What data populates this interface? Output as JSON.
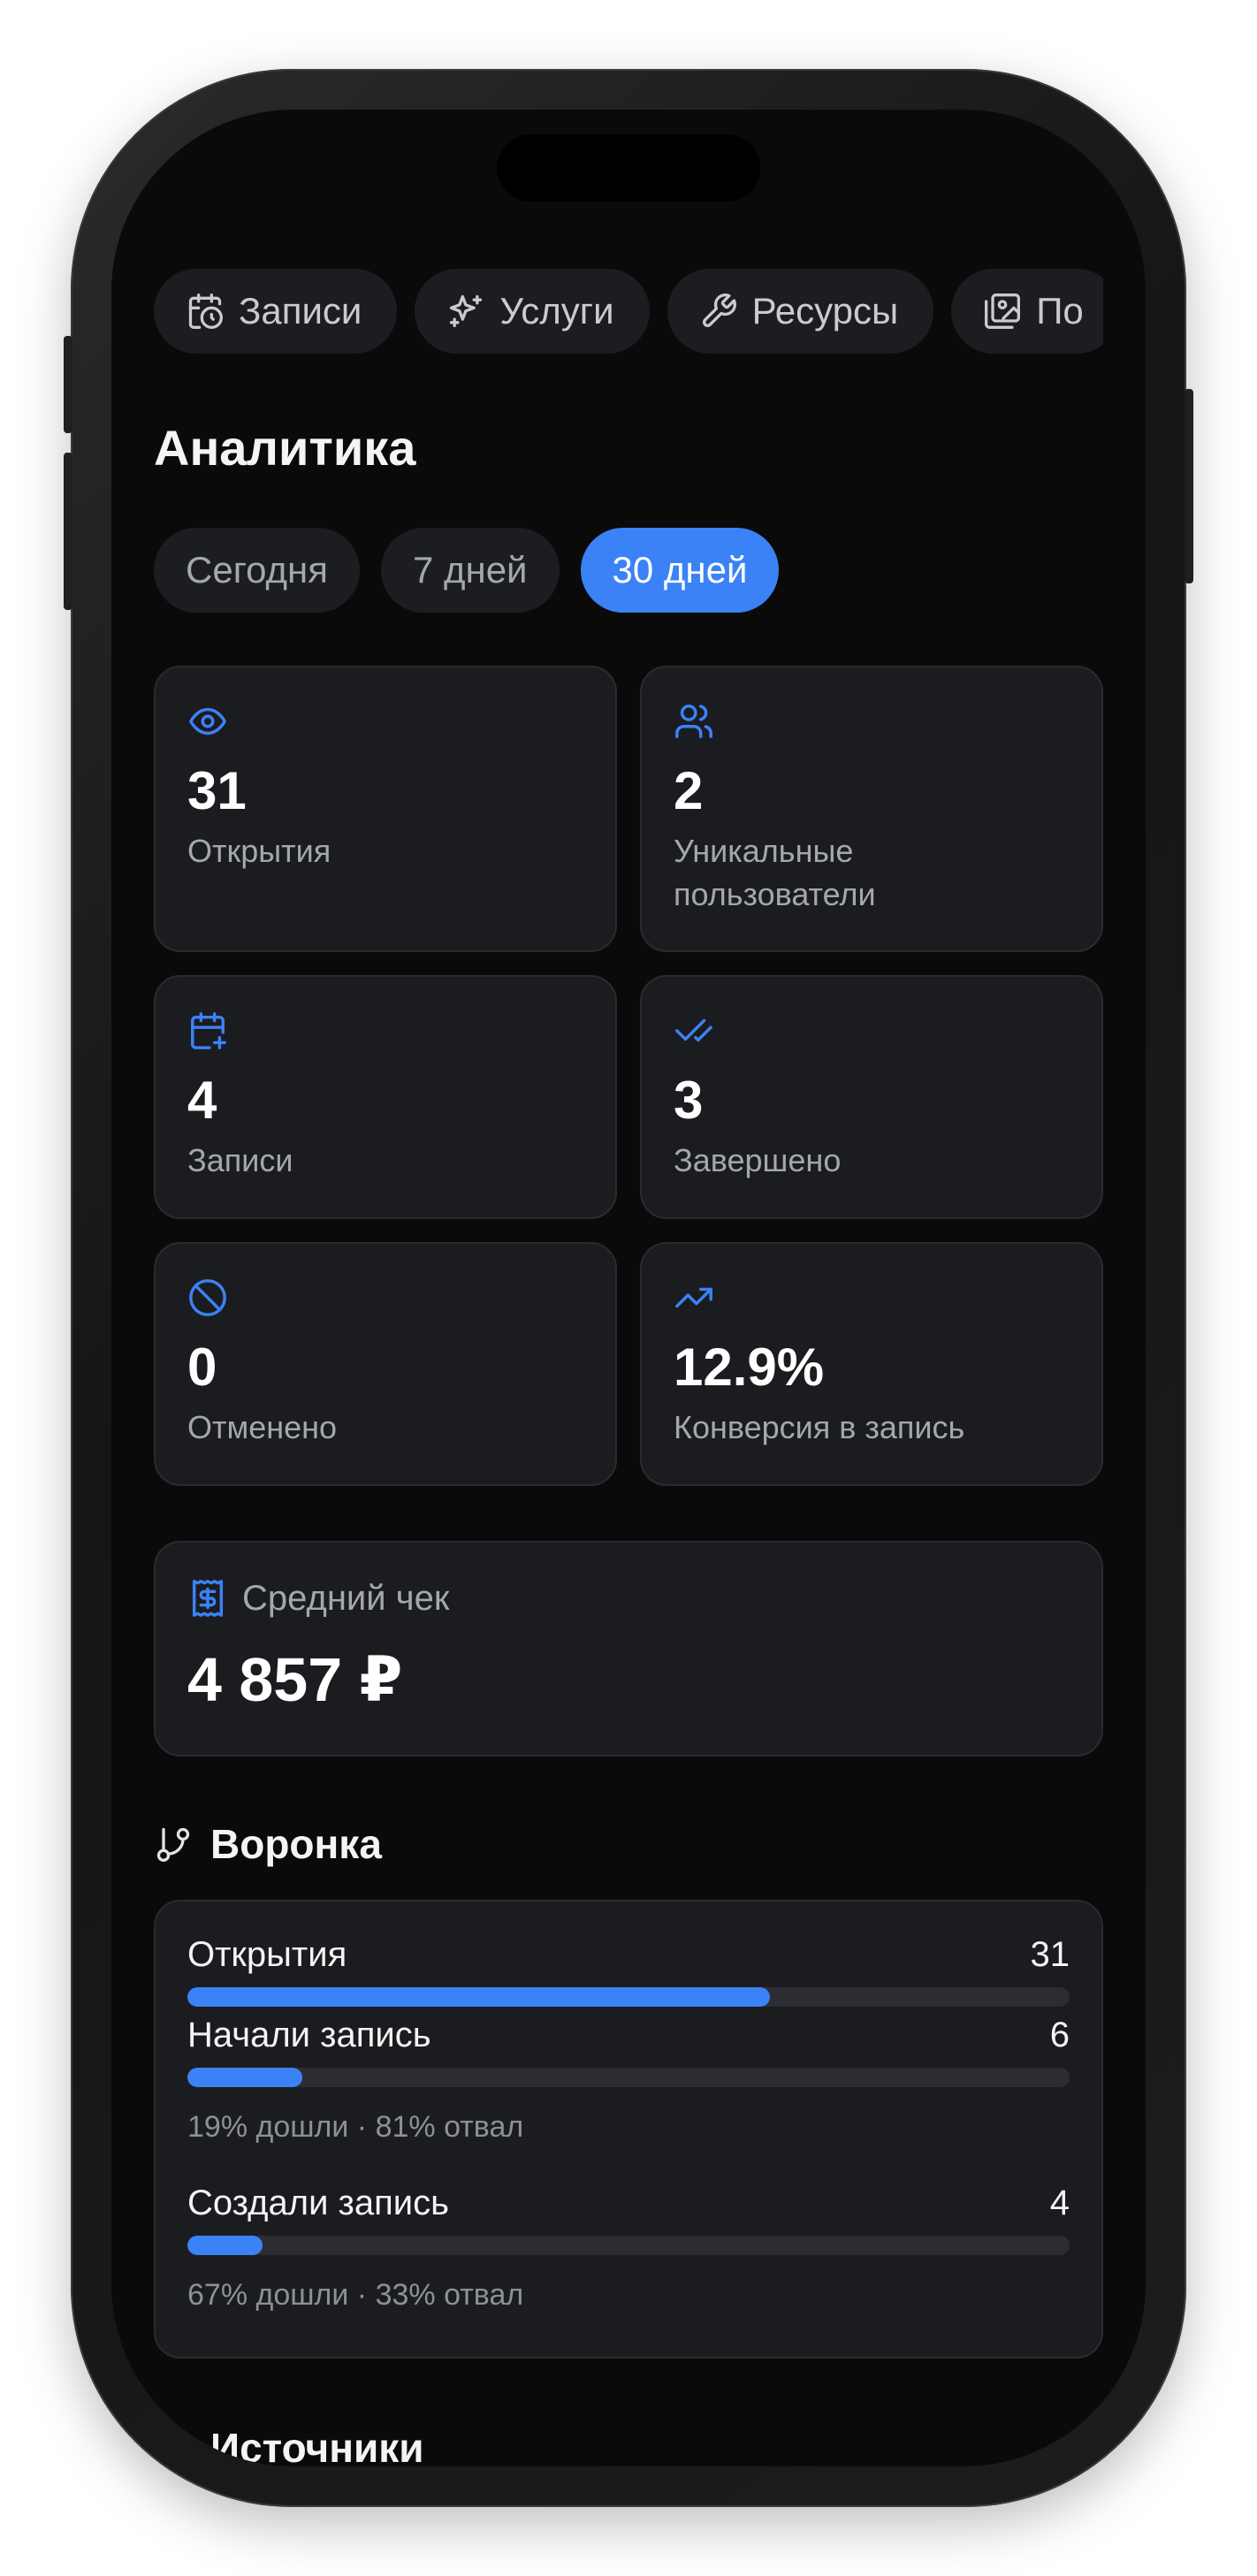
{
  "nav": {
    "items": [
      {
        "label": "Записи",
        "icon": "calendar-clock-icon"
      },
      {
        "label": "Услуги",
        "icon": "sparkles-icon"
      },
      {
        "label": "Ресурсы",
        "icon": "wrench-icon"
      },
      {
        "label": "По",
        "icon": "images-icon"
      }
    ]
  },
  "page": {
    "title": "Аналитика"
  },
  "periods": [
    {
      "label": "Сегодня",
      "active": false
    },
    {
      "label": "7 дней",
      "active": false
    },
    {
      "label": "30 дней",
      "active": true
    }
  ],
  "stats": [
    {
      "value": "31",
      "label": "Открытия",
      "icon": "eye-icon"
    },
    {
      "value": "2",
      "label": "Уникальные пользователи",
      "icon": "users-icon"
    },
    {
      "value": "4",
      "label": "Записи",
      "icon": "calendar-plus-icon"
    },
    {
      "value": "3",
      "label": "Завершено",
      "icon": "check-check-icon"
    },
    {
      "value": "0",
      "label": "Отменено",
      "icon": "ban-icon"
    },
    {
      "value": "12.9%",
      "label": "Конверсия в запись",
      "icon": "trending-up-icon"
    }
  ],
  "avg_check": {
    "label": "Средний чек",
    "value": "4 857 ₽",
    "icon": "receipt-icon"
  },
  "funnel": {
    "title": "Воронка",
    "icon": "git-branch-icon",
    "rows": [
      {
        "label": "Открытия",
        "value": "31",
        "fill": 0.66,
        "note": ""
      },
      {
        "label": "Начали запись",
        "value": "6",
        "fill": 0.13,
        "note": "19% дошли · 81% отвал"
      },
      {
        "label": "Создали запись",
        "value": "4",
        "fill": 0.085,
        "note": "67% дошли · 33% отвал"
      }
    ]
  },
  "sources": {
    "title": "Источники"
  },
  "colors": {
    "accent": "#3b82f6",
    "card": "#1b1c1f",
    "background": "#0a0a0b"
  }
}
